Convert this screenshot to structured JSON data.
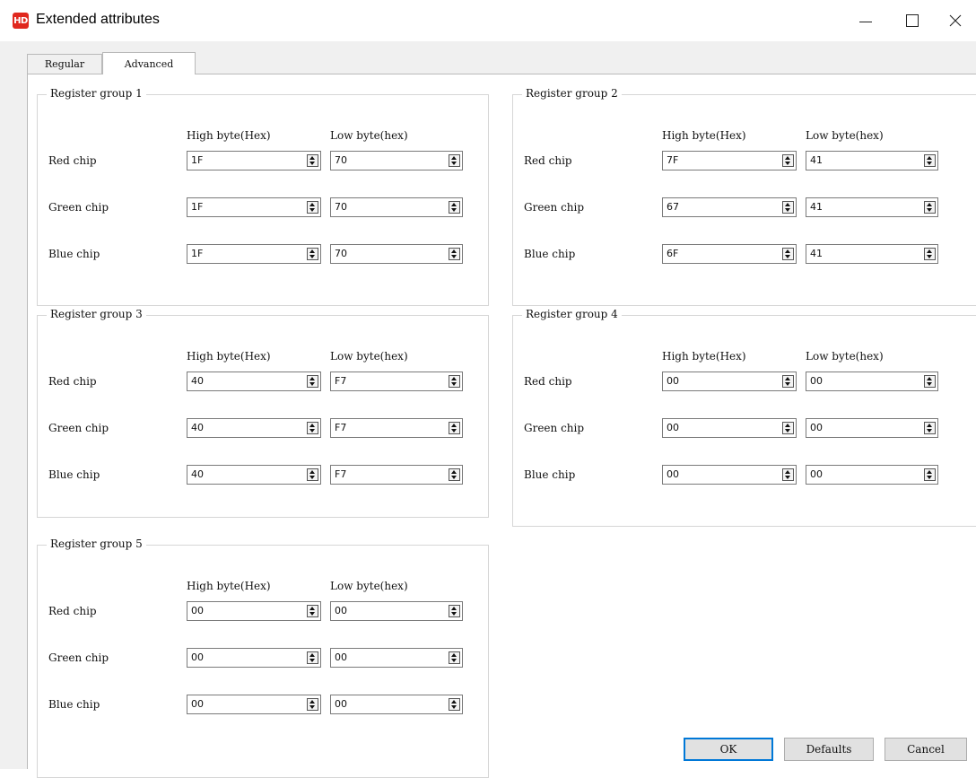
{
  "window": {
    "icon_text": "HD",
    "title": "Extended attributes",
    "controls": {
      "minimize": "minimize-icon",
      "maximize": "maximize-icon",
      "close": "close-icon"
    },
    "close_glyph": "×"
  },
  "tabs": [
    {
      "label": "Regular",
      "selected": false
    },
    {
      "label": "Advanced",
      "selected": true
    }
  ],
  "groups": [
    {
      "title": "Register group 1",
      "col_high": "High byte(Hex)",
      "col_low": "Low byte(hex)",
      "rows": [
        {
          "label": "Red chip",
          "high": "1F",
          "low": "70"
        },
        {
          "label": "Green chip",
          "high": "1F",
          "low": "70"
        },
        {
          "label": "Blue chip",
          "high": "1F",
          "low": "70"
        }
      ]
    },
    {
      "title": "Register group 2",
      "col_high": "High byte(Hex)",
      "col_low": "Low byte(hex)",
      "rows": [
        {
          "label": "Red chip",
          "high": "7F",
          "low": "41"
        },
        {
          "label": "Green chip",
          "high": "67",
          "low": "41"
        },
        {
          "label": "Blue chip",
          "high": "6F",
          "low": "41"
        }
      ]
    },
    {
      "title": "Register group 3",
      "col_high": "High byte(Hex)",
      "col_low": "Low byte(hex)",
      "rows": [
        {
          "label": "Red chip",
          "high": "40",
          "low": "F7"
        },
        {
          "label": "Green chip",
          "high": "40",
          "low": "F7"
        },
        {
          "label": "Blue chip",
          "high": "40",
          "low": "F7"
        }
      ]
    },
    {
      "title": "Register group 4",
      "col_high": "High byte(Hex)",
      "col_low": "Low byte(hex)",
      "rows": [
        {
          "label": "Red chip",
          "high": "00",
          "low": "00"
        },
        {
          "label": "Green chip",
          "high": "00",
          "low": "00"
        },
        {
          "label": "Blue chip",
          "high": "00",
          "low": "00"
        }
      ]
    },
    {
      "title": "Register group 5",
      "col_high": "High byte(Hex)",
      "col_low": "Low byte(hex)",
      "rows": [
        {
          "label": "Red chip",
          "high": "00",
          "low": "00"
        },
        {
          "label": "Green chip",
          "high": "00",
          "low": "00"
        },
        {
          "label": "Blue chip",
          "high": "00",
          "low": "00"
        }
      ]
    }
  ],
  "buttons": {
    "ok": "OK",
    "defaults": "Defaults",
    "cancel": "Cancel"
  },
  "colors": {
    "app_icon": "#e0281e",
    "default_button_border": "#0078d7",
    "dialog_background": "#f0f0f0"
  }
}
